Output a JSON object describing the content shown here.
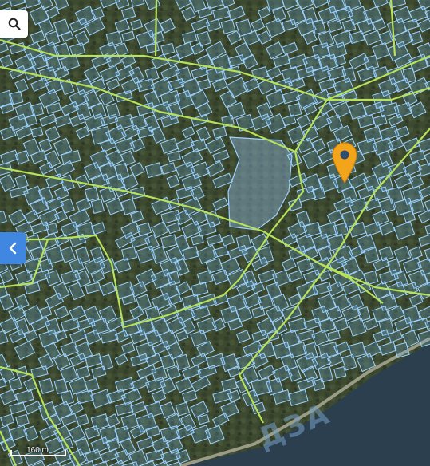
{
  "map": {
    "scale_label": "160 m",
    "water_label": "ДЗА",
    "colors": {
      "parcel_stroke": "#9fd3ff",
      "parcel_fill": "rgba(120,190,255,0.22)",
      "block_stroke": "#b6e35a",
      "pin": "#f2a41b",
      "side_button": "#3f87e0"
    }
  },
  "controls": {
    "search_icon": "search-icon",
    "sidebar_toggle_icon": "chevron-left-icon",
    "marker_icon": "map-pin-icon"
  }
}
